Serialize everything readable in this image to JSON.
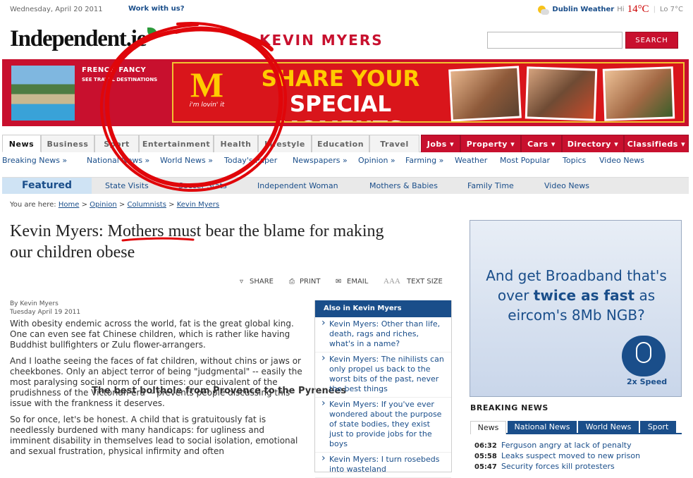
{
  "topbar": {
    "date": "Wednesday, April 20 2011",
    "work_with_us": "Work with us?"
  },
  "weather": {
    "city": "Dublin Weather",
    "hi_label": "Hi",
    "hi": "14°C",
    "separator": "|",
    "lo": "Lo 7°C"
  },
  "logo": {
    "text": "Independent.ie"
  },
  "section_title": "KEVIN MYERS",
  "search": {
    "value": "",
    "button": "SEARCH"
  },
  "promo": {
    "kicker": "FRENCH FANCY",
    "body": "The best bolthole from Provence to the Pyrenees",
    "link": "SEE TRAVEL DESTINATIONS"
  },
  "ad": {
    "brand": "M",
    "tagline": "i'm lovin' it",
    "line1": "SHARE YOUR",
    "line2": "SPECIAL MOMENTS"
  },
  "nav": {
    "tabs": [
      "News",
      "Business",
      "Sport",
      "Entertainment",
      "Health",
      "Lifestyle",
      "Education",
      "Travel"
    ],
    "red_tabs": [
      "Jobs ▾",
      "Property ▾",
      "Cars ▾",
      "Directory ▾",
      "Classifieds ▾"
    ]
  },
  "subnav": [
    "Breaking News »",
    "National News »",
    "World News »",
    "Today's Paper",
    "Newspapers »",
    "Opinion »",
    "Farming »",
    "Weather",
    "Most Popular",
    "Topics",
    "Video News"
  ],
  "featured": {
    "title": "Featured",
    "items": [
      "State Visits",
      "Soccer Stats",
      "Independent Woman",
      "Mothers & Babies",
      "Family Time",
      "Video News"
    ]
  },
  "breadcrumb": {
    "prefix": "You are here:",
    "items": [
      "Home",
      "Opinion",
      "Columnists",
      "Kevin Myers"
    ],
    "sep": ">"
  },
  "article": {
    "headline": "Kevin Myers: Mothers must bear the blame for making our children obese",
    "tools": [
      "SHARE",
      "PRINT",
      "EMAIL",
      "TEXT SIZE"
    ],
    "text_size_glyph": "AAA",
    "byline": "By Kevin Myers",
    "dateline": "Tuesday April 19 2011",
    "paragraphs": [
      "With obesity endemic across the world, fat is the great global king. One can even see fat Chinese children, which is rather like having Buddhist bullfighters or Zulu flower-arrangers.",
      "And I loathe seeing the faces of fat children, without chins or jaws or cheekbones. Only an abject terror of being \"judgmental\" -- easily the most paralysing social norm of our times: our equivalent of the prudishness of the Victorian era -- prevents people discussing this issue with the frankness it deserves.",
      "So for once, let's be honest. A child that is gratuitously fat is needlessly burdened with many handicaps: for ugliness and imminent disability in themselves lead to social isolation, emotional and sexual frustration, physical infirmity and often"
    ]
  },
  "also": {
    "title": "Also in Kevin Myers",
    "items": [
      "Kevin Myers: Other than life, death, rags and riches, what's in a name?",
      "Kevin Myers: The nihilists can only propel us back to the worst bits of the past, never the best things",
      "Kevin Myers: If you've ever wondered about the purpose of state bodies, they exist just to provide jobs for the boys",
      "Kevin Myers: I turn rosebeds into wasteland"
    ]
  },
  "broadband_ad": {
    "line1": "And get Broadband that's",
    "line2a": "over ",
    "line2b": "twice as fast",
    "line2c": " as",
    "line3": "eircom's 8Mb NGB?",
    "speed": "2x Speed"
  },
  "breaking": {
    "title": "BREAKING NEWS",
    "tabs": [
      "News",
      "National News",
      "World News",
      "Sport"
    ],
    "rows": [
      {
        "time": "06:32",
        "text": "Ferguson angry at lack of penalty"
      },
      {
        "time": "05:58",
        "text": "Leaks suspect moved to new prison"
      },
      {
        "time": "05:47",
        "text": "Security forces kill protesters"
      }
    ]
  },
  "colors": {
    "brand_red": "#c8102e",
    "link_blue": "#1a4e8a",
    "ad_yellow": "#ffcc00"
  }
}
